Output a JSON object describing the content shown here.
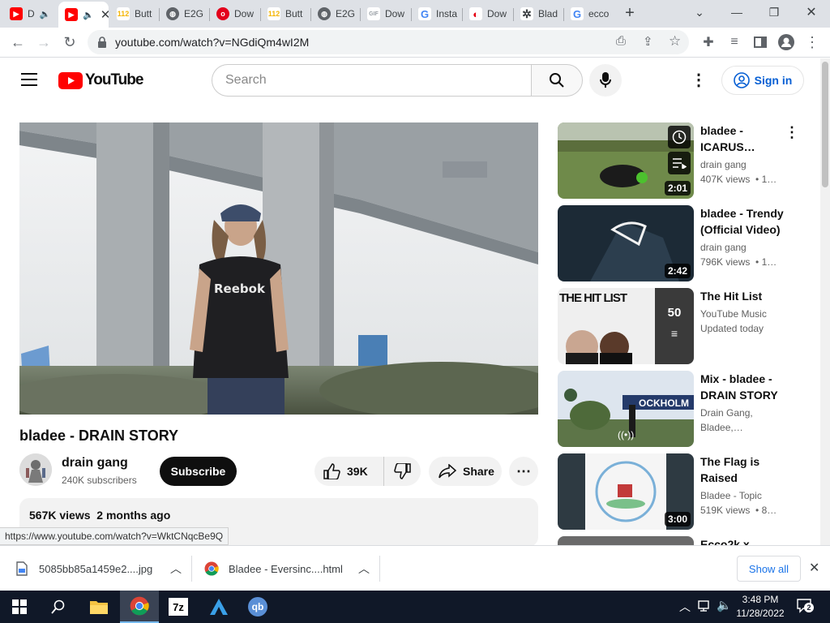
{
  "browser": {
    "tabs": [
      {
        "label": "D",
        "favicon": "youtube-icon",
        "color": "#ff0000"
      },
      {
        "label": "",
        "favicon": "youtube-icon",
        "color": "#ff0000",
        "active": true
      },
      {
        "label": "Butt",
        "favicon": "112-icon",
        "color": "#f4b400"
      },
      {
        "label": "E2G",
        "favicon": "globe-icon",
        "color": "#5f6368"
      },
      {
        "label": "Dow",
        "favicon": "opera-icon",
        "color": "#e3001b"
      },
      {
        "label": "Butt",
        "favicon": "112-icon",
        "color": "#f4b400"
      },
      {
        "label": "E2G",
        "favicon": "globe-icon",
        "color": "#5f6368"
      },
      {
        "label": "Dow",
        "favicon": "gif-icon",
        "color": "#9aa0a6"
      },
      {
        "label": "Insta",
        "favicon": "google-icon",
        "color": "#4285f4"
      },
      {
        "label": "Dow",
        "favicon": "nintendo-icon",
        "color": "#e60012"
      },
      {
        "label": "Blad",
        "favicon": "openai-icon",
        "color": "#3c4043"
      },
      {
        "label": "ecco",
        "favicon": "google-icon",
        "color": "#4285f4"
      }
    ],
    "url": "youtube.com/watch?v=NGdiQm4wI2M",
    "status_url": "https://www.youtube.com/watch?v=WktCNqcBe9Q"
  },
  "youtube": {
    "logo_text": "YouTube",
    "search_placeholder": "Search",
    "signin_label": "Sign in"
  },
  "video": {
    "title": "bladee - DRAIN STORY",
    "channel": "drain gang",
    "subscribers": "240K subscribers",
    "subscribe_label": "Subscribe",
    "likes": "39K",
    "share_label": "Share",
    "views": "567K views",
    "age": "2 months ago",
    "shirt_text": "Reebok"
  },
  "recommendations": [
    {
      "title_l1": "bladee -",
      "title_l2": "ICARUS…",
      "channel": "drain gang",
      "views": "407K views",
      "age": "• 1…",
      "duration": "2:01"
    },
    {
      "title_l1": "bladee - Trendy",
      "title_l2": "(Official Video)",
      "channel": "drain gang",
      "views": "796K views",
      "age": "• 1…",
      "duration": "2:42"
    },
    {
      "title_l1": "The Hit List",
      "title_l2": "",
      "channel": "YouTube Music",
      "views": "Updated today",
      "age": "",
      "playlist_count": "50",
      "thumb_text": "THE HIT LIST"
    },
    {
      "title_l1": "Mix - bladee -",
      "title_l2": "DRAIN STORY",
      "channel": "Drain Gang,",
      "views": "Bladee,…",
      "age": "",
      "thumb_text": "OCKHOLM"
    },
    {
      "title_l1": "The Flag is",
      "title_l2": "Raised",
      "channel": "Bladee - Topic",
      "views": "519K views",
      "age": "• 8…",
      "duration": "3:00"
    },
    {
      "title_l1": "Ecco2k x",
      "title_l2": "",
      "channel": "",
      "views": "",
      "age": ""
    }
  ],
  "downloads": [
    {
      "name": "5085bb85a1459e2....jpg",
      "icon": "file-icon"
    },
    {
      "name": "Bladee - Eversinc....html",
      "icon": "chrome-icon"
    }
  ],
  "downloads_show_all": "Show all",
  "taskbar": {
    "time": "3:48 PM",
    "date": "11/28/2022",
    "notifications": "2",
    "apps": [
      "start-icon",
      "search-icon",
      "file-explorer-icon",
      "chrome-icon",
      "7zip-icon",
      "a-app-icon",
      "qbittorrent-icon"
    ],
    "app_7z": "7z",
    "app_qb": "qb"
  }
}
